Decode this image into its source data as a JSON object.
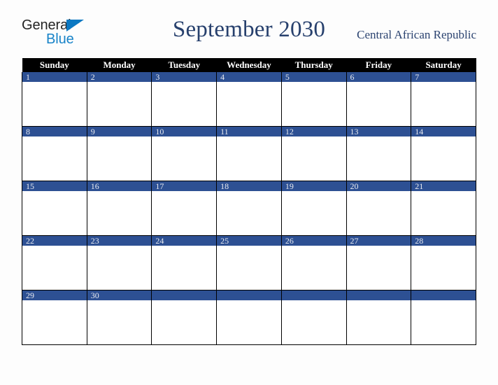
{
  "brand": {
    "name_part1": "General",
    "name_part2": "Blue",
    "triangle_color": "#0b78c2",
    "text_color_1": "#232323",
    "text_color_2": "#1783c8"
  },
  "header": {
    "title": "September 2030",
    "country": "Central African Republic",
    "title_color": "#27406d"
  },
  "calendar": {
    "month": "September",
    "year": "2030",
    "weekday_headers": [
      "Sunday",
      "Monday",
      "Tuesday",
      "Wednesday",
      "Thursday",
      "Friday",
      "Saturday"
    ],
    "header_bg": "#000000",
    "header_fg": "#ffffff",
    "daynum_bg": "#2d5093",
    "daynum_fg": "#e8eaf0",
    "cell_bg": "#ffffff",
    "border_color": "#000000",
    "weeks": [
      [
        {
          "day": "1",
          "empty": false
        },
        {
          "day": "2",
          "empty": false
        },
        {
          "day": "3",
          "empty": false
        },
        {
          "day": "4",
          "empty": false
        },
        {
          "day": "5",
          "empty": false
        },
        {
          "day": "6",
          "empty": false
        },
        {
          "day": "7",
          "empty": false
        }
      ],
      [
        {
          "day": "8",
          "empty": false
        },
        {
          "day": "9",
          "empty": false
        },
        {
          "day": "10",
          "empty": false
        },
        {
          "day": "11",
          "empty": false
        },
        {
          "day": "12",
          "empty": false
        },
        {
          "day": "13",
          "empty": false
        },
        {
          "day": "14",
          "empty": false
        }
      ],
      [
        {
          "day": "15",
          "empty": false
        },
        {
          "day": "16",
          "empty": false
        },
        {
          "day": "17",
          "empty": false
        },
        {
          "day": "18",
          "empty": false
        },
        {
          "day": "19",
          "empty": false
        },
        {
          "day": "20",
          "empty": false
        },
        {
          "day": "21",
          "empty": false
        }
      ],
      [
        {
          "day": "22",
          "empty": false
        },
        {
          "day": "23",
          "empty": false
        },
        {
          "day": "24",
          "empty": false
        },
        {
          "day": "25",
          "empty": false
        },
        {
          "day": "26",
          "empty": false
        },
        {
          "day": "27",
          "empty": false
        },
        {
          "day": "28",
          "empty": false
        }
      ],
      [
        {
          "day": "29",
          "empty": false
        },
        {
          "day": "30",
          "empty": false
        },
        {
          "day": "",
          "empty": true
        },
        {
          "day": "",
          "empty": true
        },
        {
          "day": "",
          "empty": true
        },
        {
          "day": "",
          "empty": true
        },
        {
          "day": "",
          "empty": true
        }
      ]
    ]
  }
}
